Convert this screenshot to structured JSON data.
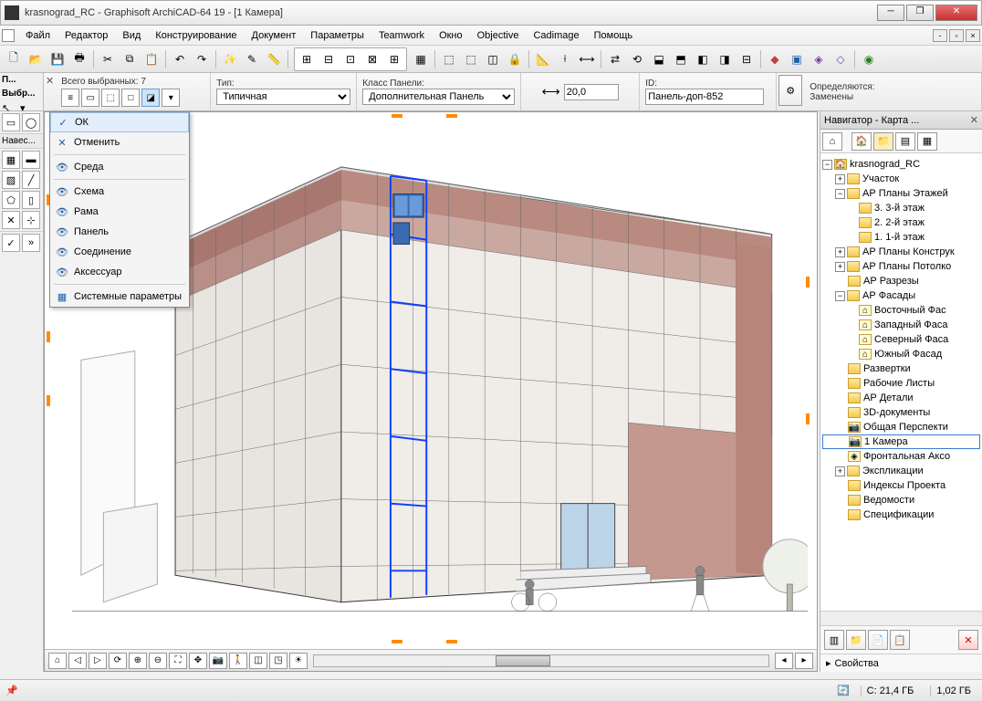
{
  "window": {
    "title": "krasnograd_RC - Graphisoft ArchiCAD-64 19 - [1 Камера]"
  },
  "menu": {
    "items": [
      "Файл",
      "Редактор",
      "Вид",
      "Конструирование",
      "Документ",
      "Параметры",
      "Teamwork",
      "Окно",
      "Objective",
      "Cadimage",
      "Помощь"
    ]
  },
  "mini_palette": {
    "line1": "П...",
    "line2": "Выбр..."
  },
  "left_palette": {
    "header": "Навес..."
  },
  "infobar": {
    "selection_label": "Всего выбранных: 7",
    "type_label": "Тип:",
    "type_value": "Типичная",
    "panel_class_label": "Класс Панели:",
    "panel_class_value": "Дополнительная Панель",
    "offset_value": "20,0",
    "id_label": "ID:",
    "id_value": "Панель-доп-852",
    "defined_label": "Определяются:",
    "replaced_label": "Заменены"
  },
  "context_menu": {
    "ok": "ОК",
    "cancel": "Отменить",
    "env": "Среда",
    "scheme": "Схема",
    "frame": "Рама",
    "panel": "Панель",
    "joint": "Соединение",
    "accessory": "Аксессуар",
    "sys_params": "Системные параметры"
  },
  "navigator": {
    "title": "Навигатор - Карта ...",
    "project": "krasnograd_RC",
    "site": "Участок",
    "floor_plans": "АР Планы Этажей",
    "floor3": "3. 3-й этаж",
    "floor2": "2. 2-й этаж",
    "floor1": "1. 1-й этаж",
    "struct_plans": "АР Планы Конструк",
    "ceil_plans": "АР Планы Потолко",
    "sections_r": "АР Разрезы",
    "facades": "АР Фасады",
    "east": "Восточный Фас",
    "west": "Западный Фаса",
    "north": "Северный Фаса",
    "south": "Южный Фасад",
    "elevations": "Развертки",
    "worksheets": "Рабочие Листы",
    "details": "АР Детали",
    "docs3d": "3D-документы",
    "perspective": "Общая Перспекти",
    "camera1": "1 Камера",
    "axo": "Фронтальная Аксо",
    "schedules": "Экспликации",
    "indexes": "Индексы Проекта",
    "lists": "Ведомости",
    "specs": "Спецификации",
    "properties": "Свойства"
  },
  "status": {
    "mem1": "C: 21,4 ГБ",
    "mem2": "1,02 ГБ"
  }
}
